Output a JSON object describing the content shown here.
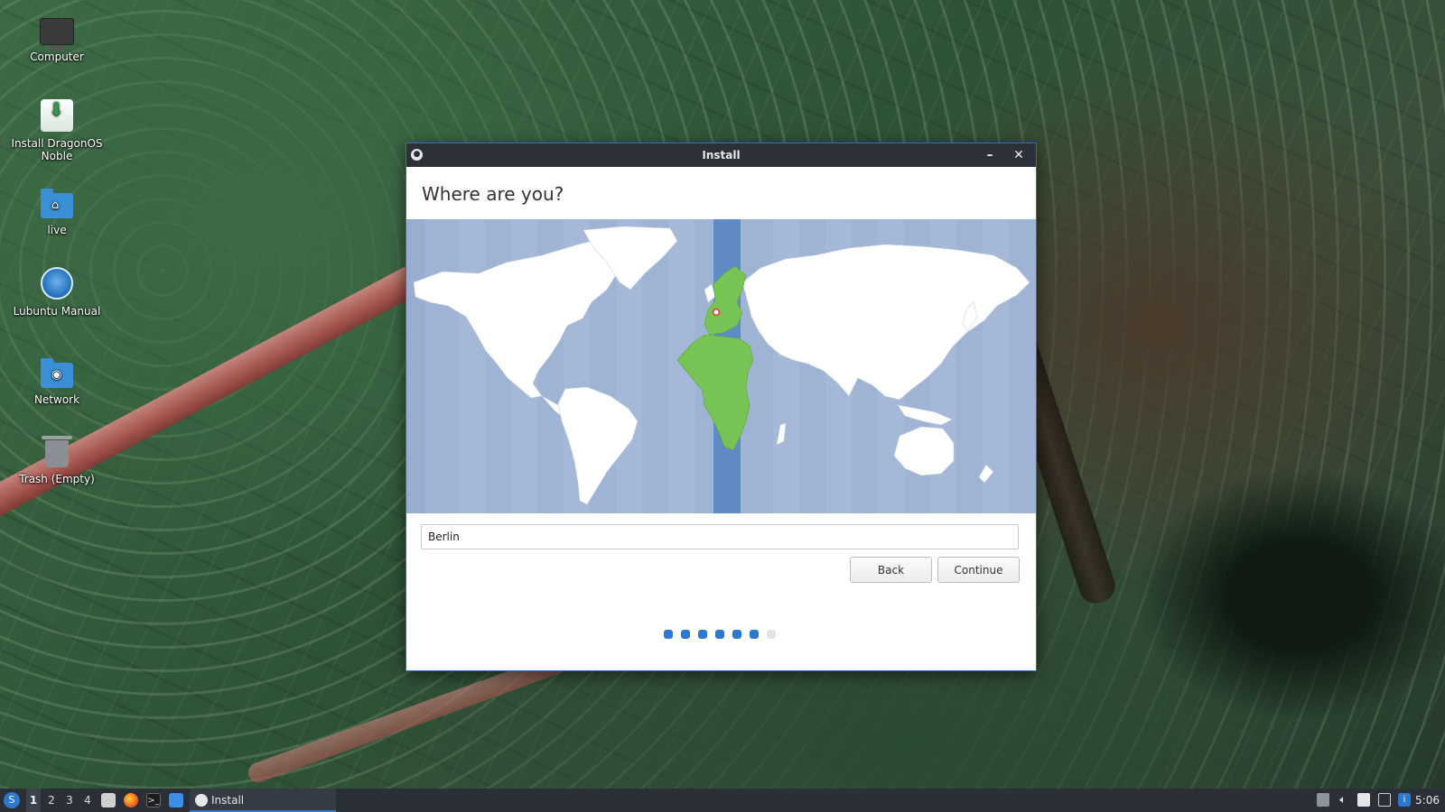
{
  "desktop": {
    "icons": [
      {
        "label": "Computer",
        "icon": "computer-icon"
      },
      {
        "label": "Install DragonOS Noble",
        "icon": "installer-icon"
      },
      {
        "label": "live",
        "icon": "home-folder-icon"
      },
      {
        "label": "Lubuntu Manual",
        "icon": "manual-icon"
      },
      {
        "label": "Network",
        "icon": "network-folder-icon"
      },
      {
        "label": "Trash (Empty)",
        "icon": "trash-icon"
      }
    ]
  },
  "window": {
    "title": "Install",
    "minimize_glyph": "–",
    "close_glyph": "✕",
    "heading": "Where are you?",
    "location_value": "Berlin",
    "back_label": "Back",
    "continue_label": "Continue",
    "steps_total": 7,
    "steps_completed": 6,
    "colors": {
      "accent": "#2f78d0",
      "selected_timezone": "#77c353",
      "ocean": "#9fb3d4",
      "land": "#ffffff"
    }
  },
  "taskbar": {
    "desktops": [
      "1",
      "2",
      "3",
      "4"
    ],
    "active_desktop": "1",
    "task_label": "Install",
    "clock": "5:06"
  }
}
